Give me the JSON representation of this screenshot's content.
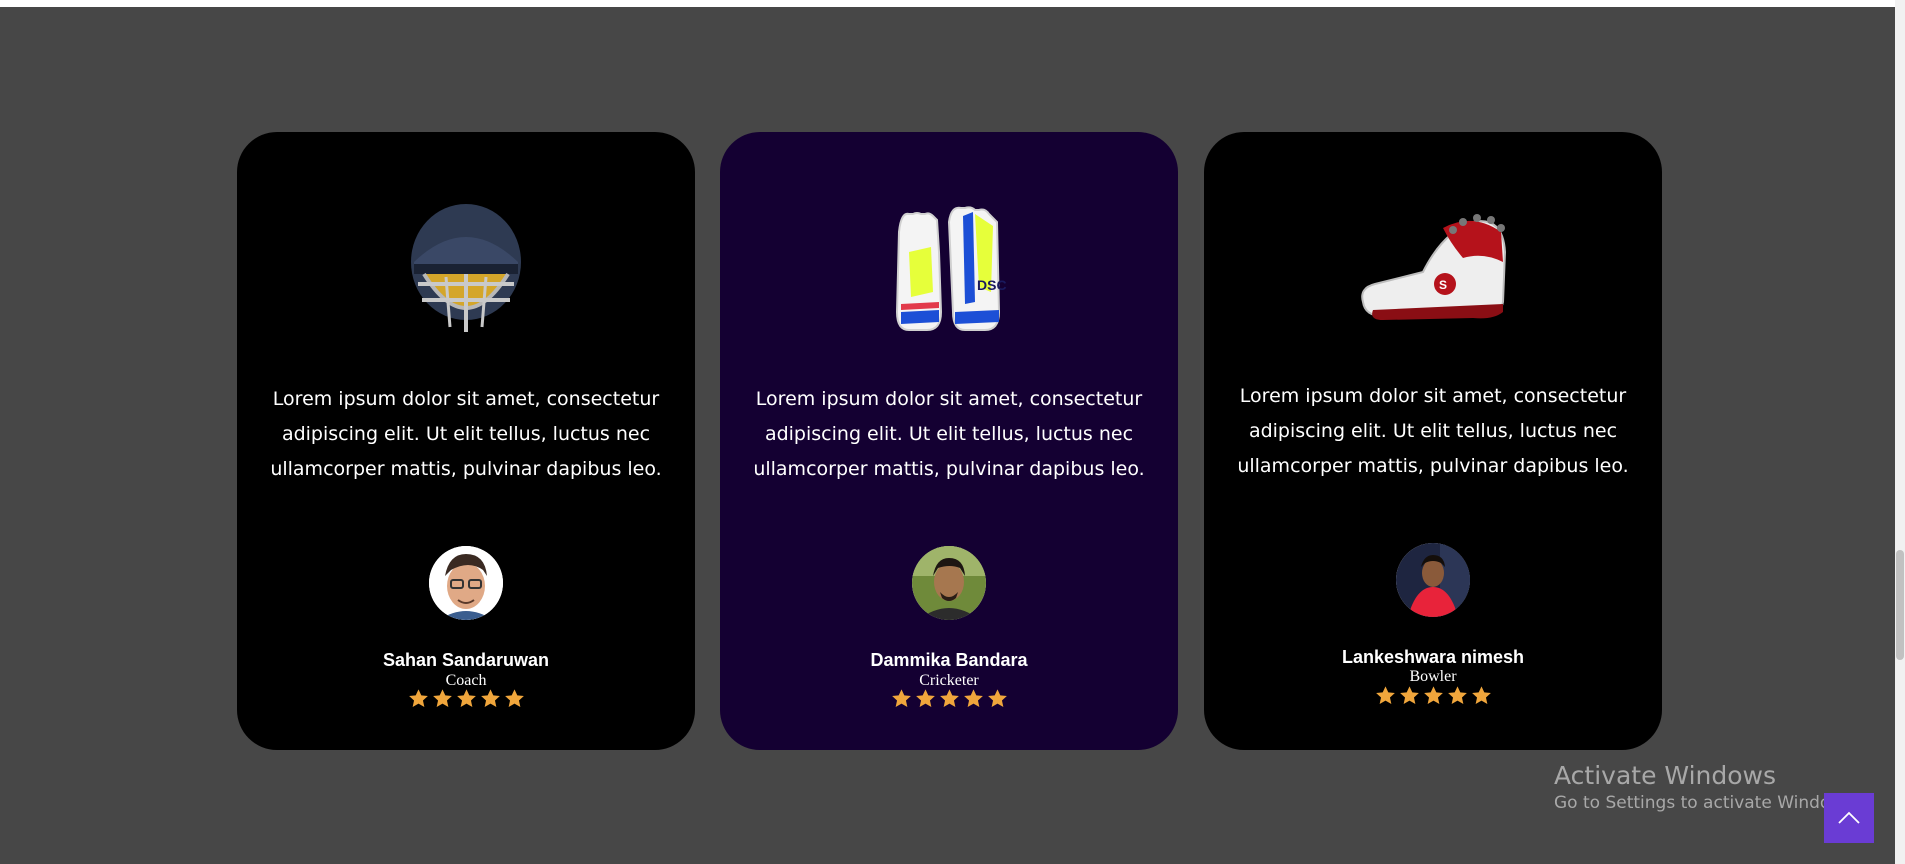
{
  "testimonials": [
    {
      "product_icon": "cricket-helmet-icon",
      "quote": "Lorem ipsum dolor sit amet, consectetur adipiscing elit. Ut elit tellus, luctus nec ullamcorper mattis, pulvinar dapibus leo.",
      "name": "Sahan Sandaruwan",
      "role": "Coach",
      "rating": 5
    },
    {
      "product_icon": "batting-gloves-icon",
      "quote": "Lorem ipsum dolor sit amet, consectetur adipiscing elit. Ut elit tellus, luctus nec ullamcorper mattis, pulvinar dapibus leo.",
      "name": "Dammika Bandara",
      "role": "Cricketer",
      "rating": 5
    },
    {
      "product_icon": "cricket-shoe-icon",
      "quote": "Lorem ipsum dolor sit amet, consectetur adipiscing elit. Ut elit tellus, luctus nec ullamcorper mattis, pulvinar dapibus leo.",
      "name": "Lankeshwara nimesh",
      "role": "Bowler",
      "rating": 5
    }
  ],
  "watermark": {
    "title": "Activate Windows",
    "subtitle": "Go to Settings to activate Windows."
  },
  "scroll_top_icon": "chevron-up-icon",
  "colors": {
    "page_bg": "#474747",
    "card_bg": "#000000",
    "card_highlight_bg": "#140032",
    "star": "#f0a63c",
    "scroll_top_button": "#6a3cd4"
  }
}
